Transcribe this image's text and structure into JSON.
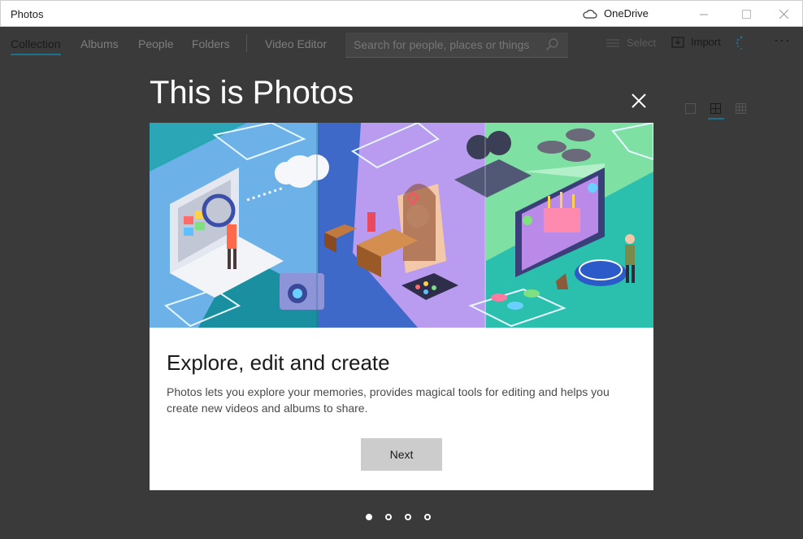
{
  "window": {
    "title": "Photos",
    "onedrive_label": "OneDrive"
  },
  "nav": {
    "tabs": [
      "Collection",
      "Albums",
      "People",
      "Folders",
      "Video Editor"
    ],
    "active_tab": "Collection",
    "search_placeholder": "Search for people, places or things",
    "select_label": "Select",
    "import_label": "Import"
  },
  "dialog": {
    "title": "This is Photos",
    "heading": "Explore, edit and create",
    "body": "Photos lets you explore your memories, provides magical tools for editing and helps you create new videos and albums to share.",
    "next_label": "Next",
    "page_count": 4,
    "current_page": 1
  },
  "colors": {
    "accent": "#1f6f8b",
    "backdrop": "#3a3a3a",
    "button": "#cccccc"
  }
}
